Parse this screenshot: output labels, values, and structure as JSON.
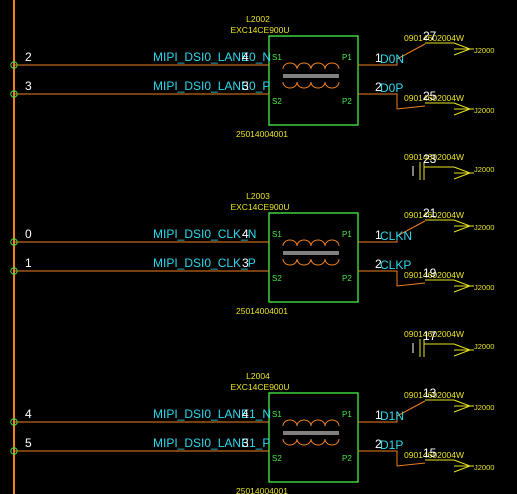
{
  "transformers": [
    {
      "ref": "L2002",
      "part": "EXC14CE900U",
      "code": "25014004001",
      "pin_s1": "S1",
      "pin_s2": "S2",
      "pin_p1": "P1",
      "pin_p2": "P2",
      "in_top_num": "4",
      "in_bot_num": "3",
      "out_top_num": "1",
      "out_bot_num": "2",
      "net_top": {
        "bus_index": "2",
        "name": "MIPI_DSI0_LANE0_N",
        "out_label": "D0N",
        "conn_pin": "27",
        "conn_part": "09014602004W",
        "conn_ref": "J2000"
      },
      "net_bot": {
        "bus_index": "3",
        "name": "MIPI_DSI0_LANE0_P",
        "out_label": "D0P",
        "conn_pin": "25",
        "conn_part": "09014602004W",
        "conn_ref": "J2000"
      },
      "gnd": {
        "conn_pin": "23",
        "conn_part": "09014602004W",
        "conn_ref": "J2000"
      }
    },
    {
      "ref": "L2003",
      "part": "EXC14CE900U",
      "code": "25014004001",
      "pin_s1": "S1",
      "pin_s2": "S2",
      "pin_p1": "P1",
      "pin_p2": "P2",
      "in_top_num": "4",
      "in_bot_num": "3",
      "out_top_num": "1",
      "out_bot_num": "2",
      "net_top": {
        "bus_index": "0",
        "name": "MIPI_DSI0_CLK_N",
        "out_label": "CLKN",
        "conn_pin": "21",
        "conn_part": "09014602004W",
        "conn_ref": "J2000"
      },
      "net_bot": {
        "bus_index": "1",
        "name": "MIPI_DSI0_CLK_P",
        "out_label": "CLKP",
        "conn_pin": "19",
        "conn_part": "09014602004W",
        "conn_ref": "J2000"
      },
      "gnd": {
        "conn_pin": "17",
        "conn_part": "09014602004W",
        "conn_ref": "J2000"
      }
    },
    {
      "ref": "L2004",
      "part": "EXC14CE900U",
      "code": "25014004001",
      "pin_s1": "S1",
      "pin_s2": "S2",
      "pin_p1": "P1",
      "pin_p2": "P2",
      "in_top_num": "4",
      "in_bot_num": "3",
      "out_top_num": "1",
      "out_bot_num": "2",
      "net_top": {
        "bus_index": "4",
        "name": "MIPI_DSI0_LANE1_N",
        "out_label": "D1N",
        "conn_pin": "13",
        "conn_part": "09014602004W",
        "conn_ref": "J2000"
      },
      "net_bot": {
        "bus_index": "5",
        "name": "MIPI_DSI0_LANE1_P",
        "out_label": "D1P",
        "conn_pin": "15",
        "conn_part": "09014602004W",
        "conn_ref": "J2000"
      }
    }
  ],
  "colors": {
    "background": "#000000",
    "wire": "#f08020",
    "component": "#40e040",
    "net_label": "#2fd8ee",
    "ref_text": "#e8e222",
    "pin_number": "#ffffff"
  }
}
